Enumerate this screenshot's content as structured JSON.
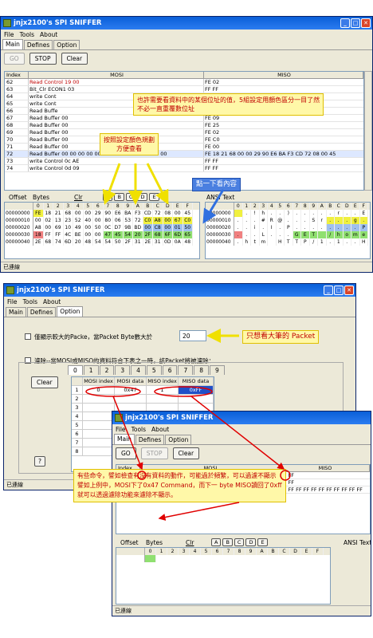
{
  "top": {
    "title": "jnjx2100's SPI SNIFFER",
    "menu": [
      "File",
      "Tools",
      "About"
    ],
    "tabs": [
      "Main",
      "Defines",
      "Option"
    ],
    "buttons": {
      "go": "GO",
      "stop": "STOP",
      "clear": "Clear"
    },
    "cols": {
      "index": "Index",
      "mosi": "MOSI",
      "miso": "MISO"
    },
    "rows": [
      {
        "i": "62",
        "mo": "Read Control 19 00",
        "mi": "FE 02"
      },
      {
        "i": "63",
        "mo": "Bit_Clr ECON1 03",
        "mi": "FF FF"
      },
      {
        "i": "64",
        "mo": "write Cont",
        "mi": "FF FF"
      },
      {
        "i": "65",
        "mo": "write Cont",
        "mi": "FF FF"
      },
      {
        "i": "66",
        "mo": "Read Buffe",
        "mi": "FF FF"
      },
      {
        "i": "67",
        "mo": "Read Buffer 00",
        "mi": "FE 09"
      },
      {
        "i": "68",
        "mo": "Read Buffer 00",
        "mi": "FE 25"
      },
      {
        "i": "69",
        "mo": "Read Buffer 00",
        "mi": "FE 02"
      },
      {
        "i": "70",
        "mo": "Read Buffer 00",
        "mi": "FE C0"
      },
      {
        "i": "71",
        "mo": "Read Buffer 00",
        "mi": "FE 00"
      },
      {
        "i": "72",
        "mo": "Read Buffer 00 00 00 00 00 00 00 00 00 00 00 00 00",
        "mi": "FE 18 21 68 00 00 29 90 E6 BA F3 CD 72 08 00 45"
      },
      {
        "i": "73",
        "mo": "write Control 0c AE",
        "mi": "FF FF"
      },
      {
        "i": "74",
        "mo": "write Control 0d 09",
        "mi": "FF FF"
      }
    ],
    "hex": {
      "offset": "Offset",
      "bytes": "Bytes",
      "clr": "Clr",
      "marks": [
        "A",
        "B",
        "C",
        "D",
        "E"
      ],
      "cols": [
        "0",
        "1",
        "2",
        "3",
        "4",
        "5",
        "6",
        "7",
        "8",
        "9",
        "A",
        "B",
        "C",
        "D",
        "E",
        "F"
      ],
      "rows": [
        {
          "a": "00000000",
          "b": [
            "FE",
            "18",
            "21",
            "68",
            "00",
            "00",
            "29",
            "90",
            "E6",
            "BA",
            "F3",
            "CD",
            "72",
            "08",
            "00",
            "45"
          ]
        },
        {
          "a": "00000010",
          "b": [
            "00",
            "02",
            "13",
            "23",
            "52",
            "40",
            "00",
            "80",
            "06",
            "53",
            "72",
            "C0",
            "A8",
            "00",
            "67",
            "C0"
          ]
        },
        {
          "a": "00000020",
          "b": [
            "A8",
            "00",
            "69",
            "10",
            "49",
            "00",
            "50",
            "0C",
            "D7",
            "9B",
            "BD",
            "00",
            "C8",
            "00",
            "01",
            "50"
          ]
        },
        {
          "a": "00000030",
          "b": [
            "18",
            "FF",
            "FF",
            "4C",
            "BE",
            "00",
            "00",
            "47",
            "45",
            "54",
            "20",
            "2F",
            "68",
            "6F",
            "6D",
            "65"
          ]
        },
        {
          "a": "00000040",
          "b": [
            "2E",
            "68",
            "74",
            "6D",
            "20",
            "48",
            "54",
            "54",
            "50",
            "2F",
            "31",
            "2E",
            "31",
            "0D",
            "0A",
            "48"
          ]
        }
      ]
    },
    "ansi": {
      "title": "ANSI Text",
      "cols": [
        "0",
        "1",
        "2",
        "3",
        "4",
        "5",
        "6",
        "7",
        "8",
        "9",
        "A",
        "B",
        "C",
        "D",
        "E",
        "F"
      ],
      "rows": [
        {
          "a": "00000000",
          "t": [
            "",
            ".",
            "!",
            "h",
            ".",
            ".",
            ")",
            ".",
            ".",
            ".",
            ".",
            ".",
            "r",
            ".",
            ".",
            "E"
          ]
        },
        {
          "a": "00000010",
          "t": [
            ".",
            ".",
            ".",
            "#",
            "R",
            "@",
            ".",
            ".",
            ".",
            "S",
            "r",
            ".",
            ".",
            ".",
            "g",
            "."
          ]
        },
        {
          "a": "00000020",
          "t": [
            ".",
            ".",
            "i",
            ".",
            "I",
            ".",
            "P",
            ".",
            ".",
            ".",
            ".",
            ".",
            ".",
            ".",
            ".",
            "P"
          ]
        },
        {
          "a": "00000030",
          "t": [
            ".",
            ".",
            ".",
            "L",
            ".",
            ".",
            ".",
            "G",
            "E",
            "T",
            "",
            "/",
            "h",
            "o",
            "m",
            "e"
          ]
        },
        {
          "a": "00000040",
          "t": [
            ".",
            "h",
            "t",
            "m",
            "",
            "H",
            "T",
            "T",
            "P",
            "/",
            "1",
            ".",
            "1",
            ".",
            ".",
            "H"
          ]
        }
      ]
    },
    "status": "已連線",
    "notes": {
      "n1": "也許需要看資料中的某個位址的值，5組設定用顏色區分一目了然\n不必一直重覆數位址",
      "n2": "按照設定顏色規劃\n方便查看",
      "n3": "點一下看內容"
    }
  },
  "bottom": {
    "title": "jnjx2100's SPI SNIFFER",
    "menu": [
      "File",
      "Tools",
      "About"
    ],
    "tabs": [
      "Main",
      "Defines",
      "Option"
    ],
    "opt1": "僅顯示較大的Packe，當Packet Byte數大於",
    "opt1_val": "20",
    "opt2": "濾除--當MOSI或MISO的資料符合下表之一時，該Packet將被濾除：",
    "clear": "Clear",
    "q": "?",
    "ftabs": [
      "0",
      "1",
      "2",
      "3",
      "4",
      "5",
      "6",
      "7",
      "8",
      "9"
    ],
    "fcols": [
      "MOSI index",
      "MOSI data",
      "MISO index",
      "MISO data"
    ],
    "frow": {
      "n": "1",
      "mi": "0",
      "md": "0x47",
      "si": "1",
      "sd": "0xFF"
    },
    "frows": [
      "2",
      "3",
      "4",
      "5",
      "6",
      "7",
      "8"
    ],
    "status": "已連線",
    "note_big": "只想看大筆的 Packet",
    "note_filter": "有些命令，譬如檢查有沒有資料的動作，可能過於頻繁，可以過濾不顯示\n譬如上例中，MOSI下了0x47 Command，而下一 byte MISO讀回了0xff\n就可以透過濾除功能來濾除不顯示。"
  },
  "inner": {
    "title": "jnjx2100's SPI SNIFFER",
    "menu": [
      "File",
      "Tools",
      "About"
    ],
    "tabs": [
      "Main",
      "Defines",
      "Option"
    ],
    "go": "GO",
    "stop": "STOP",
    "clear": "Clear",
    "cols": {
      "index": "Index",
      "mosi": "MOSI",
      "miso": "MISO"
    },
    "rows": [
      {
        "i": "52",
        "mo": "47 FF",
        "mi": "FF FF"
      },
      {
        "i": "53",
        "mo": "7A 00",
        "mi": "FF FF"
      },
      {
        "i": "54",
        "mo": "7A FF FF FF FF FF FF 18 21 68 00 00 29 08",
        "mi": "FF FF FF FF FF FF FF FF FF FF FF"
      }
    ],
    "hex_offset": "Offset",
    "hex_bytes": "Bytes",
    "hex_clr": "Clr",
    "marks": [
      "A",
      "B",
      "C",
      "D",
      "E"
    ],
    "hex_cols": [
      "0",
      "1",
      "2",
      "3",
      "4",
      "5",
      "6",
      "7",
      "8",
      "9",
      "A",
      "B",
      "C",
      "D",
      "E",
      "F"
    ],
    "ansi": "ANSI Text",
    "status": "已連線"
  },
  "colors": {
    "yellow": "#f0f040",
    "green": "#90e070",
    "blue": "#a0c0f0",
    "red": "#f08080",
    "accent": "#0a5fd8"
  }
}
